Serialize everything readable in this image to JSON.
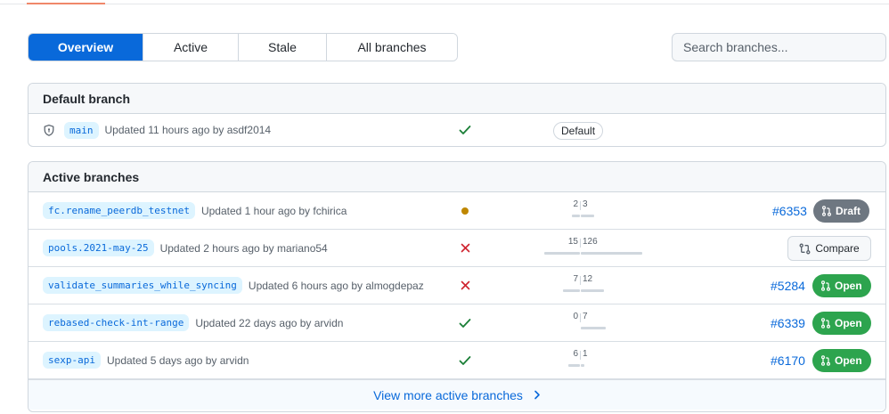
{
  "nav": {
    "tabs": [
      "Overview",
      "Active",
      "Stale",
      "All branches"
    ],
    "selected_tab": "Overview"
  },
  "search": {
    "placeholder": "Search branches..."
  },
  "default_section": {
    "title": "Default branch",
    "branch": {
      "name": "main",
      "updated": "Updated 11 hours ago by asdf2014",
      "status": "success",
      "badge": "Default"
    }
  },
  "active_section": {
    "title": "Active branches",
    "branches": [
      {
        "name": "fc.rename_peerdb_testnet",
        "updated": "Updated 1 hour ago by fchirica",
        "status": "pending",
        "behind": "2",
        "ahead": "3",
        "pr": "#6353",
        "pr_state": "Draft"
      },
      {
        "name": "pools.2021-may-25",
        "updated": "Updated 2 hours ago by mariano54",
        "status": "failure",
        "behind": "15",
        "ahead": "126",
        "action": "Compare"
      },
      {
        "name": "validate_summaries_while_syncing",
        "updated": "Updated 6 hours ago by almogdepaz",
        "status": "failure",
        "behind": "7",
        "ahead": "12",
        "pr": "#5284",
        "pr_state": "Open"
      },
      {
        "name": "rebased-check-int-range",
        "updated": "Updated 22 days ago by arvidn",
        "status": "success",
        "behind": "0",
        "ahead": "7",
        "pr": "#6339",
        "pr_state": "Open"
      },
      {
        "name": "sexp-api",
        "updated": "Updated 5 days ago by arvidn",
        "status": "success",
        "behind": "6",
        "ahead": "1",
        "pr": "#6170",
        "pr_state": "Open"
      }
    ],
    "view_more": "View more active branches"
  },
  "icons": {
    "default_branch": "shield-icon",
    "pr": "git-pull-request-icon",
    "compare": "git-compare-icon",
    "success": "check-icon",
    "failure": "x-icon",
    "pending": "dot-icon",
    "more": "chevron-right-icon"
  },
  "colors": {
    "accent": "#0969da",
    "success": "#1a7f37",
    "failure": "#cf222e",
    "pending": "#bf8700",
    "open_badge": "#2da44e",
    "draft_badge": "#6e7781"
  }
}
